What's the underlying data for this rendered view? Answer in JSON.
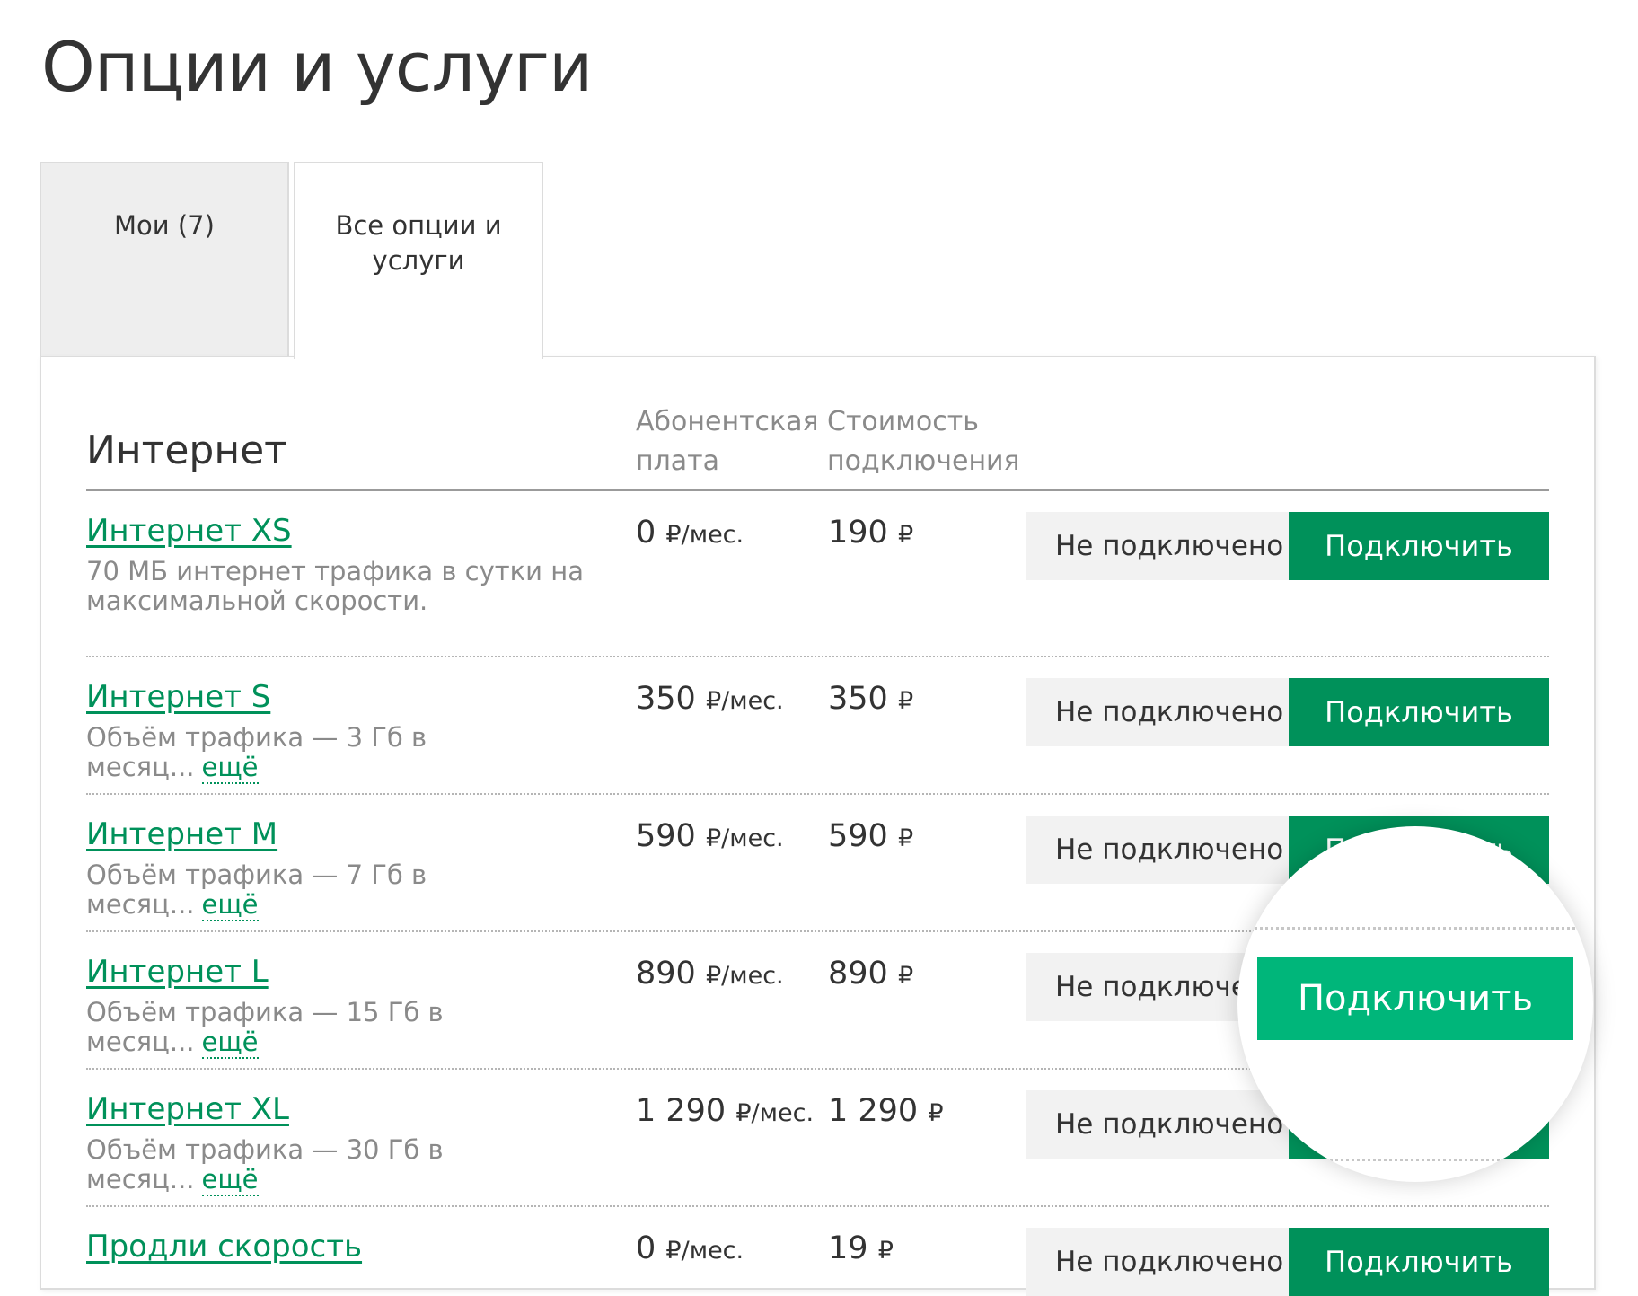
{
  "page": {
    "title": "Опции и услуги"
  },
  "tabs": [
    {
      "label": "Мои (7)"
    },
    {
      "label": "Все опции и услуги"
    }
  ],
  "section": {
    "title": "Интернет",
    "columns": {
      "fee": "Абонентская плата",
      "cost": "Стоимость подключения"
    }
  },
  "rows": [
    {
      "name": "Интернет XS",
      "description": "70 МБ интернет трафика в сутки на максимальной скорости.",
      "more": "",
      "fee_value": "0",
      "fee_unit": "₽/мес.",
      "cost_value": "190",
      "cost_unit": "₽",
      "status": "Не подключено",
      "action": "Подключить"
    },
    {
      "name": "Интернет S",
      "description": "Объём трафика — 3 Гб в месяц...",
      "more": "ещё",
      "fee_value": "350",
      "fee_unit": "₽/мес.",
      "cost_value": "350",
      "cost_unit": "₽",
      "status": "Не подключено",
      "action": "Подключить"
    },
    {
      "name": "Интернет M",
      "description": "Объём трафика — 7 Гб в месяц...",
      "more": "ещё",
      "fee_value": "590",
      "fee_unit": "₽/мес.",
      "cost_value": "590",
      "cost_unit": "₽",
      "status": "Не подключено",
      "action": "Подключить"
    },
    {
      "name": "Интернет L",
      "description": "Объём трафика — 15 Гб в месяц...",
      "more": "ещё",
      "fee_value": "890",
      "fee_unit": "₽/мес.",
      "cost_value": "890",
      "cost_unit": "₽",
      "status": "Не подключено",
      "action": "Подключить"
    },
    {
      "name": "Интернет XL",
      "description": "Объём трафика — 30 Гб в месяц...",
      "more": "ещё",
      "fee_value": "1 290",
      "fee_unit": "₽/мес.",
      "cost_value": "1 290",
      "cost_unit": "₽",
      "status": "Не подключено",
      "action": "Подключить"
    },
    {
      "name": "Продли скорость",
      "description": "",
      "more": "",
      "fee_value": "0",
      "fee_unit": "₽/мес.",
      "cost_value": "19",
      "cost_unit": "₽",
      "status": "Не подключено",
      "action": "Подключить"
    }
  ],
  "magnifier": {
    "button_label": "Подключить"
  },
  "colors": {
    "brand_green": "#00915a",
    "highlight_green": "#00b67a",
    "status_bg": "#f2f2f2",
    "muted_text": "#8a8a8a"
  }
}
